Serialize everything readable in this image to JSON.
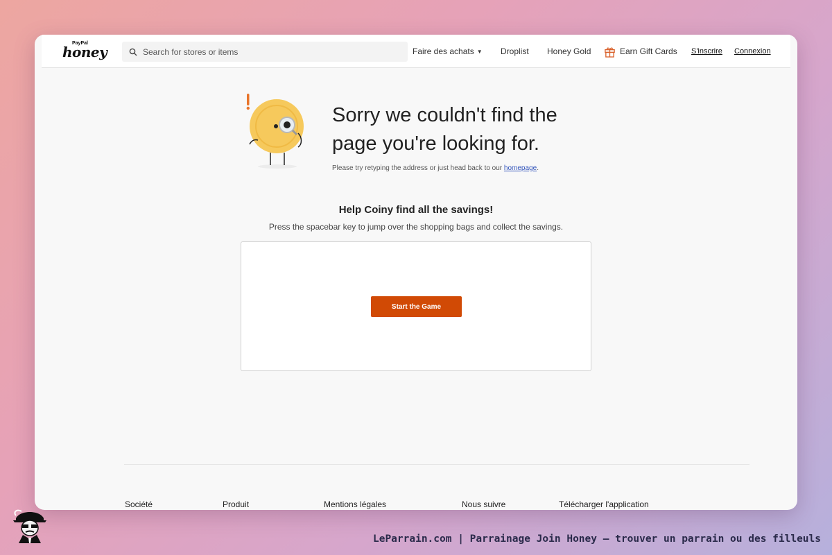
{
  "header": {
    "logo_small": "PayPal",
    "logo_main": "honey",
    "search_placeholder": "Search for stores or items",
    "nav": {
      "shop": "Faire des achats",
      "droplist": "Droplist",
      "honey_gold": "Honey Gold",
      "gift_cards": "Earn Gift Cards",
      "register": "S'inscrire",
      "login": "Connexion"
    }
  },
  "error": {
    "title": "Sorry we couldn't find the page you're looking for.",
    "message_prefix": "Please try retyping the address or just head back to our ",
    "homepage_link": "homepage",
    "message_suffix": "."
  },
  "game": {
    "title": "Help Coiny find all the savings!",
    "instructions": "Press the spacebar key to jump over the shopping bags and collect the savings.",
    "start_button": "Start the Game"
  },
  "footer": {
    "columns": [
      "Société",
      "Produit",
      "Mentions légales",
      "Nous suivre",
      "Télécharger l'application"
    ]
  },
  "caption": "LeParrain.com | Parrainage Join Honey — trouver un parrain ou des filleuls",
  "colors": {
    "accent_button": "#d14a05",
    "coin_yellow": "#f6c95c",
    "exclamation": "#e8742a",
    "link": "#3355bb"
  }
}
